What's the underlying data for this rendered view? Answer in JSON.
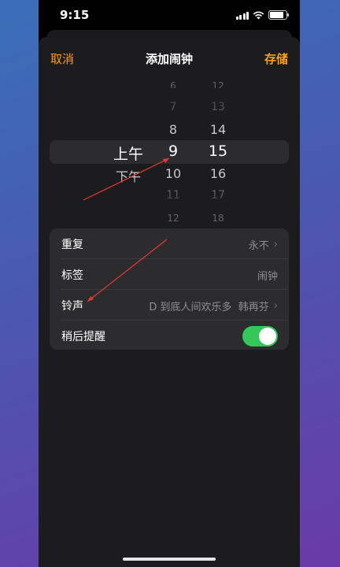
{
  "status_bar": {
    "time": "9:15"
  },
  "nav": {
    "cancel": "取消",
    "title": "添加闹钟",
    "save": "存储"
  },
  "picker": {
    "ampm": [
      "上午",
      "下午"
    ],
    "hours": [
      "6",
      "7",
      "8",
      "9",
      "10",
      "11",
      "12"
    ],
    "minutes": [
      "12",
      "13",
      "14",
      "15",
      "16",
      "17",
      "18"
    ],
    "selected": {
      "ampm": "上午",
      "hour": "9",
      "minute": "15"
    }
  },
  "settings": {
    "repeat": {
      "label": "重复",
      "value": "永不"
    },
    "tag": {
      "label": "标签",
      "placeholder": "闹钟"
    },
    "ringtone": {
      "label": "铃声",
      "value": "D 到底人间欢乐多  韩再芬"
    },
    "snooze": {
      "label": "稍后提醒",
      "enabled": true
    }
  },
  "colors": {
    "accent": "#ff9f0a",
    "toggle_on": "#34c759",
    "annotation": "#e53935"
  }
}
